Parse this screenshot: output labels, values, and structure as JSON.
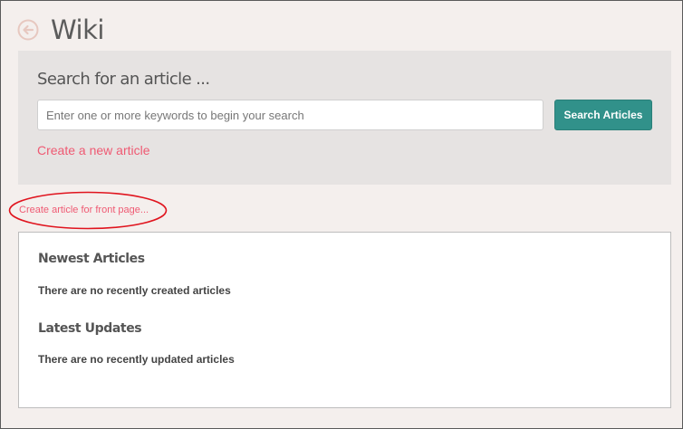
{
  "header": {
    "title": "Wiki",
    "back_icon": "circle-arrow-left-icon"
  },
  "search": {
    "heading": "Search for an article ...",
    "placeholder": "Enter one or more keywords to begin your search",
    "value": "",
    "button_label": "Search Articles",
    "create_link": "Create a new article"
  },
  "front_page_link": "Create article for front page...",
  "articles": {
    "newest_title": "Newest Articles",
    "newest_empty": "There are no recently created articles",
    "latest_title": "Latest Updates",
    "latest_empty": "There are no recently updated articles"
  },
  "colors": {
    "background": "#f4efed",
    "panel": "#e6e3e2",
    "accent_button": "#31918a",
    "link": "#ef5a73",
    "annotation": "#e0141e"
  }
}
